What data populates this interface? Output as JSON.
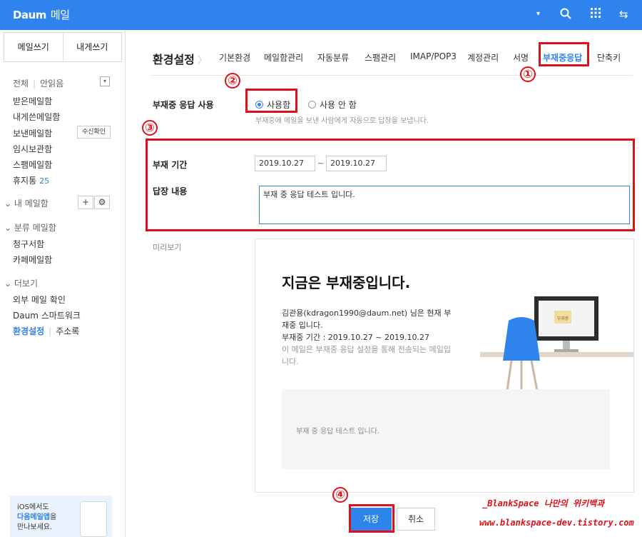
{
  "header": {
    "brand": "Daum",
    "app": "메일"
  },
  "sidebar": {
    "compose": "메일쓰기",
    "self_compose": "내게쓰기",
    "filter_all": "전체",
    "filter_unread": "안읽음",
    "folders": [
      "받은메일함",
      "내게쓴메일함",
      "보낸메일함",
      "임시보관함",
      "스팸메일함"
    ],
    "receipt_btn": "수신확인",
    "trash": "휴지통",
    "trash_count": "25",
    "my_mailbox": "내 메일함",
    "add": "+",
    "settings": "⚙",
    "category": "분류 메일함",
    "category_items": [
      "청구서함",
      "카페메일함"
    ],
    "more": "더보기",
    "more_items": [
      "외부 메일 확인",
      "Daum 스마트워크"
    ],
    "settings_link": "환경설정",
    "address_book": "주소록",
    "promo_line1": "iOS에서도",
    "promo_line2": "다음메일앱",
    "promo_line2b": "을",
    "promo_line3": "만나보세요."
  },
  "main": {
    "title": "환경설정",
    "tabs": [
      "기본환경",
      "메일함관리",
      "자동분류",
      "스팸관리",
      "IMAP/POP3",
      "계정관리",
      "서명",
      "부재중응답",
      "단축키"
    ],
    "selected_tab": "부재중응답",
    "auto_reply_label": "부재중 응답 사용",
    "radio_on": "사용함",
    "radio_off": "사용 안 함",
    "radio_desc": "부재중에 메일을 보낸 사람에게 자동으로 답장을 보냅니다.",
    "period_label": "부재 기간",
    "date_from": "2019.10.27",
    "date_sep": "~",
    "date_to": "2019.10.27",
    "reply_label": "답장 내용",
    "reply_text": "부재 중 응답 테스트 입니다.",
    "preview_label": "미리보기",
    "preview": {
      "heading": "지금은 부재중입니다.",
      "line1": "김관용(kdragon1990@daum.net) 님은 현재 부재중 입니다.",
      "line2": "부재중 기간 : 2019.10.27 ~ 2019.10.27",
      "line3": "이 메일은 부재중 응답 설정을 통해 전송되는 메일입니다.",
      "note": "부재중",
      "body": "부재 중 응답 테스트 입니다."
    },
    "save": "저장",
    "cancel": "취소"
  },
  "annotations": {
    "n1": "①",
    "n2": "②",
    "n3": "③",
    "n4": "④",
    "watermark1": "_BlankSpace 나만의 위키백과",
    "watermark2": "www.blankspace-dev.tistory.com"
  },
  "colors": {
    "brand": "#2f83ec",
    "annotation": "#e0101a"
  }
}
